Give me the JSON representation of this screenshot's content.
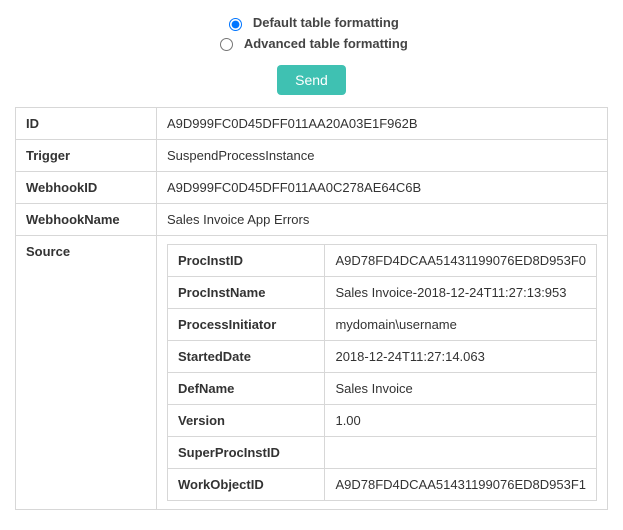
{
  "format_options": {
    "default_label": "Default table formatting",
    "advanced_label": "Advanced table formatting",
    "selected": "default"
  },
  "send_button_label": "Send",
  "table": {
    "rows": [
      {
        "key": "ID",
        "value": "A9D999FC0D45DFF011AA20A03E1F962B"
      },
      {
        "key": "Trigger",
        "value": "SuspendProcessInstance"
      },
      {
        "key": "WebhookID",
        "value": "A9D999FC0D45DFF011AA0C278AE64C6B"
      },
      {
        "key": "WebhookName",
        "value": "Sales Invoice App Errors"
      }
    ],
    "source_label": "Source",
    "source_rows": [
      {
        "key": "ProcInstID",
        "value": "A9D78FD4DCAA51431199076ED8D953F0"
      },
      {
        "key": "ProcInstName",
        "value": "Sales Invoice-2018-12-24T11:27:13:953"
      },
      {
        "key": "ProcessInitiator",
        "value": "mydomain\\username"
      },
      {
        "key": "StartedDate",
        "value": "2018-12-24T11:27:14.063"
      },
      {
        "key": "DefName",
        "value": "Sales Invoice"
      },
      {
        "key": "Version",
        "value": "1.00"
      },
      {
        "key": "SuperProcInstID",
        "value": ""
      },
      {
        "key": "WorkObjectID",
        "value": "A9D78FD4DCAA51431199076ED8D953F1"
      }
    ]
  }
}
